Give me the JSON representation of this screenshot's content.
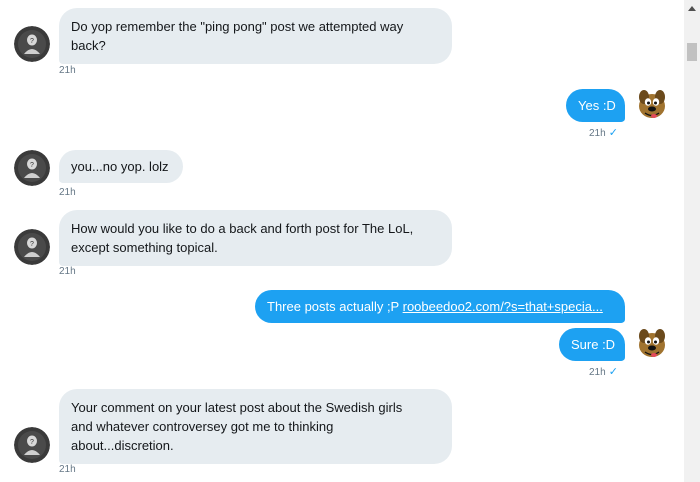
{
  "conversation": {
    "messages": [
      {
        "sender": "them",
        "lines": [
          "Do yop remember the \"ping pong\" post we attempted way",
          "back?"
        ],
        "time": "21h"
      },
      {
        "sender": "me",
        "text": "Yes :D",
        "time": "21h",
        "status": "✓"
      },
      {
        "sender": "them",
        "lines": [
          "you...no yop. lolz"
        ],
        "time": "21h"
      },
      {
        "sender": "them",
        "lines": [
          "How would you like to do a back and forth post for The LoL,",
          "except something topical."
        ],
        "time": "21h"
      },
      {
        "sender": "me",
        "text": "Three posts actually ;P",
        "link": "roobeedoo2.com/?s=that+specia..."
      },
      {
        "sender": "me",
        "text": "Sure :D",
        "time": "21h",
        "status": "✓"
      },
      {
        "sender": "them",
        "lines": [
          "Your comment on your latest post about the Swedish girls",
          "and whatever controversey got me to thinking",
          "about...discretion."
        ],
        "time": "21h"
      }
    ]
  },
  "avatars": {
    "them_icon": "gray-silhouette-avatar-icon",
    "me_icon": "scooby-doo-avatar-icon"
  },
  "colors": {
    "incoming_bubble": "#e6ecf0",
    "outgoing_bubble": "#1da1f2",
    "timestamp": "#657786",
    "read_check": "#1da1f2"
  }
}
